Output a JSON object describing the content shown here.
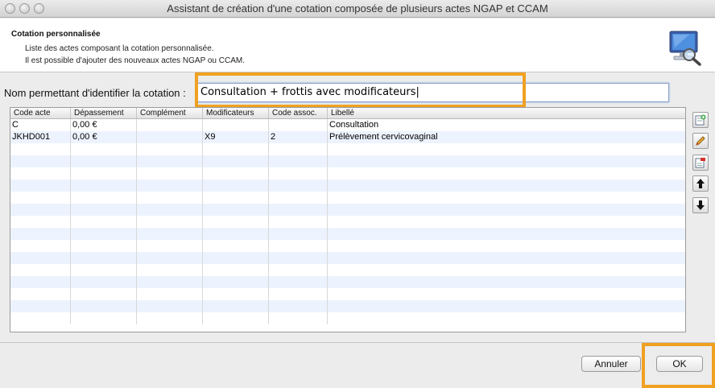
{
  "window": {
    "title": "Assistant de création d'une cotation composée de plusieurs actes NGAP et CCAM"
  },
  "header": {
    "title": "Cotation personnalisée",
    "line1": "Liste des actes composant la cotation personnalisée.",
    "line2": "Il est possible d'ajouter des nouveaux actes NGAP ou CCAM."
  },
  "name_field": {
    "label": "Nom permettant d'identifier la cotation :",
    "value": "Consultation + frottis avec modificateurs|"
  },
  "table": {
    "columns": [
      "Code acte",
      "Dépassement",
      "Complément",
      "Modificateurs",
      "Code assoc.",
      "Libellé"
    ],
    "rows": [
      [
        "C",
        "0,00 €",
        "",
        "",
        "",
        "Consultation"
      ],
      [
        "JKHD001",
        "0,00 €",
        "",
        "X9",
        "2",
        "Prélèvement cervicovaginal"
      ]
    ],
    "empty_rows": 15
  },
  "side_buttons": [
    "add-row-icon",
    "edit-icon",
    "delete-row-icon",
    "arrow-up-icon",
    "arrow-down-icon"
  ],
  "footer": {
    "cancel_label": "Annuler",
    "ok_label": "OK"
  },
  "colors": {
    "highlight": "#f0a122",
    "row_alt": "#edf3fe"
  }
}
